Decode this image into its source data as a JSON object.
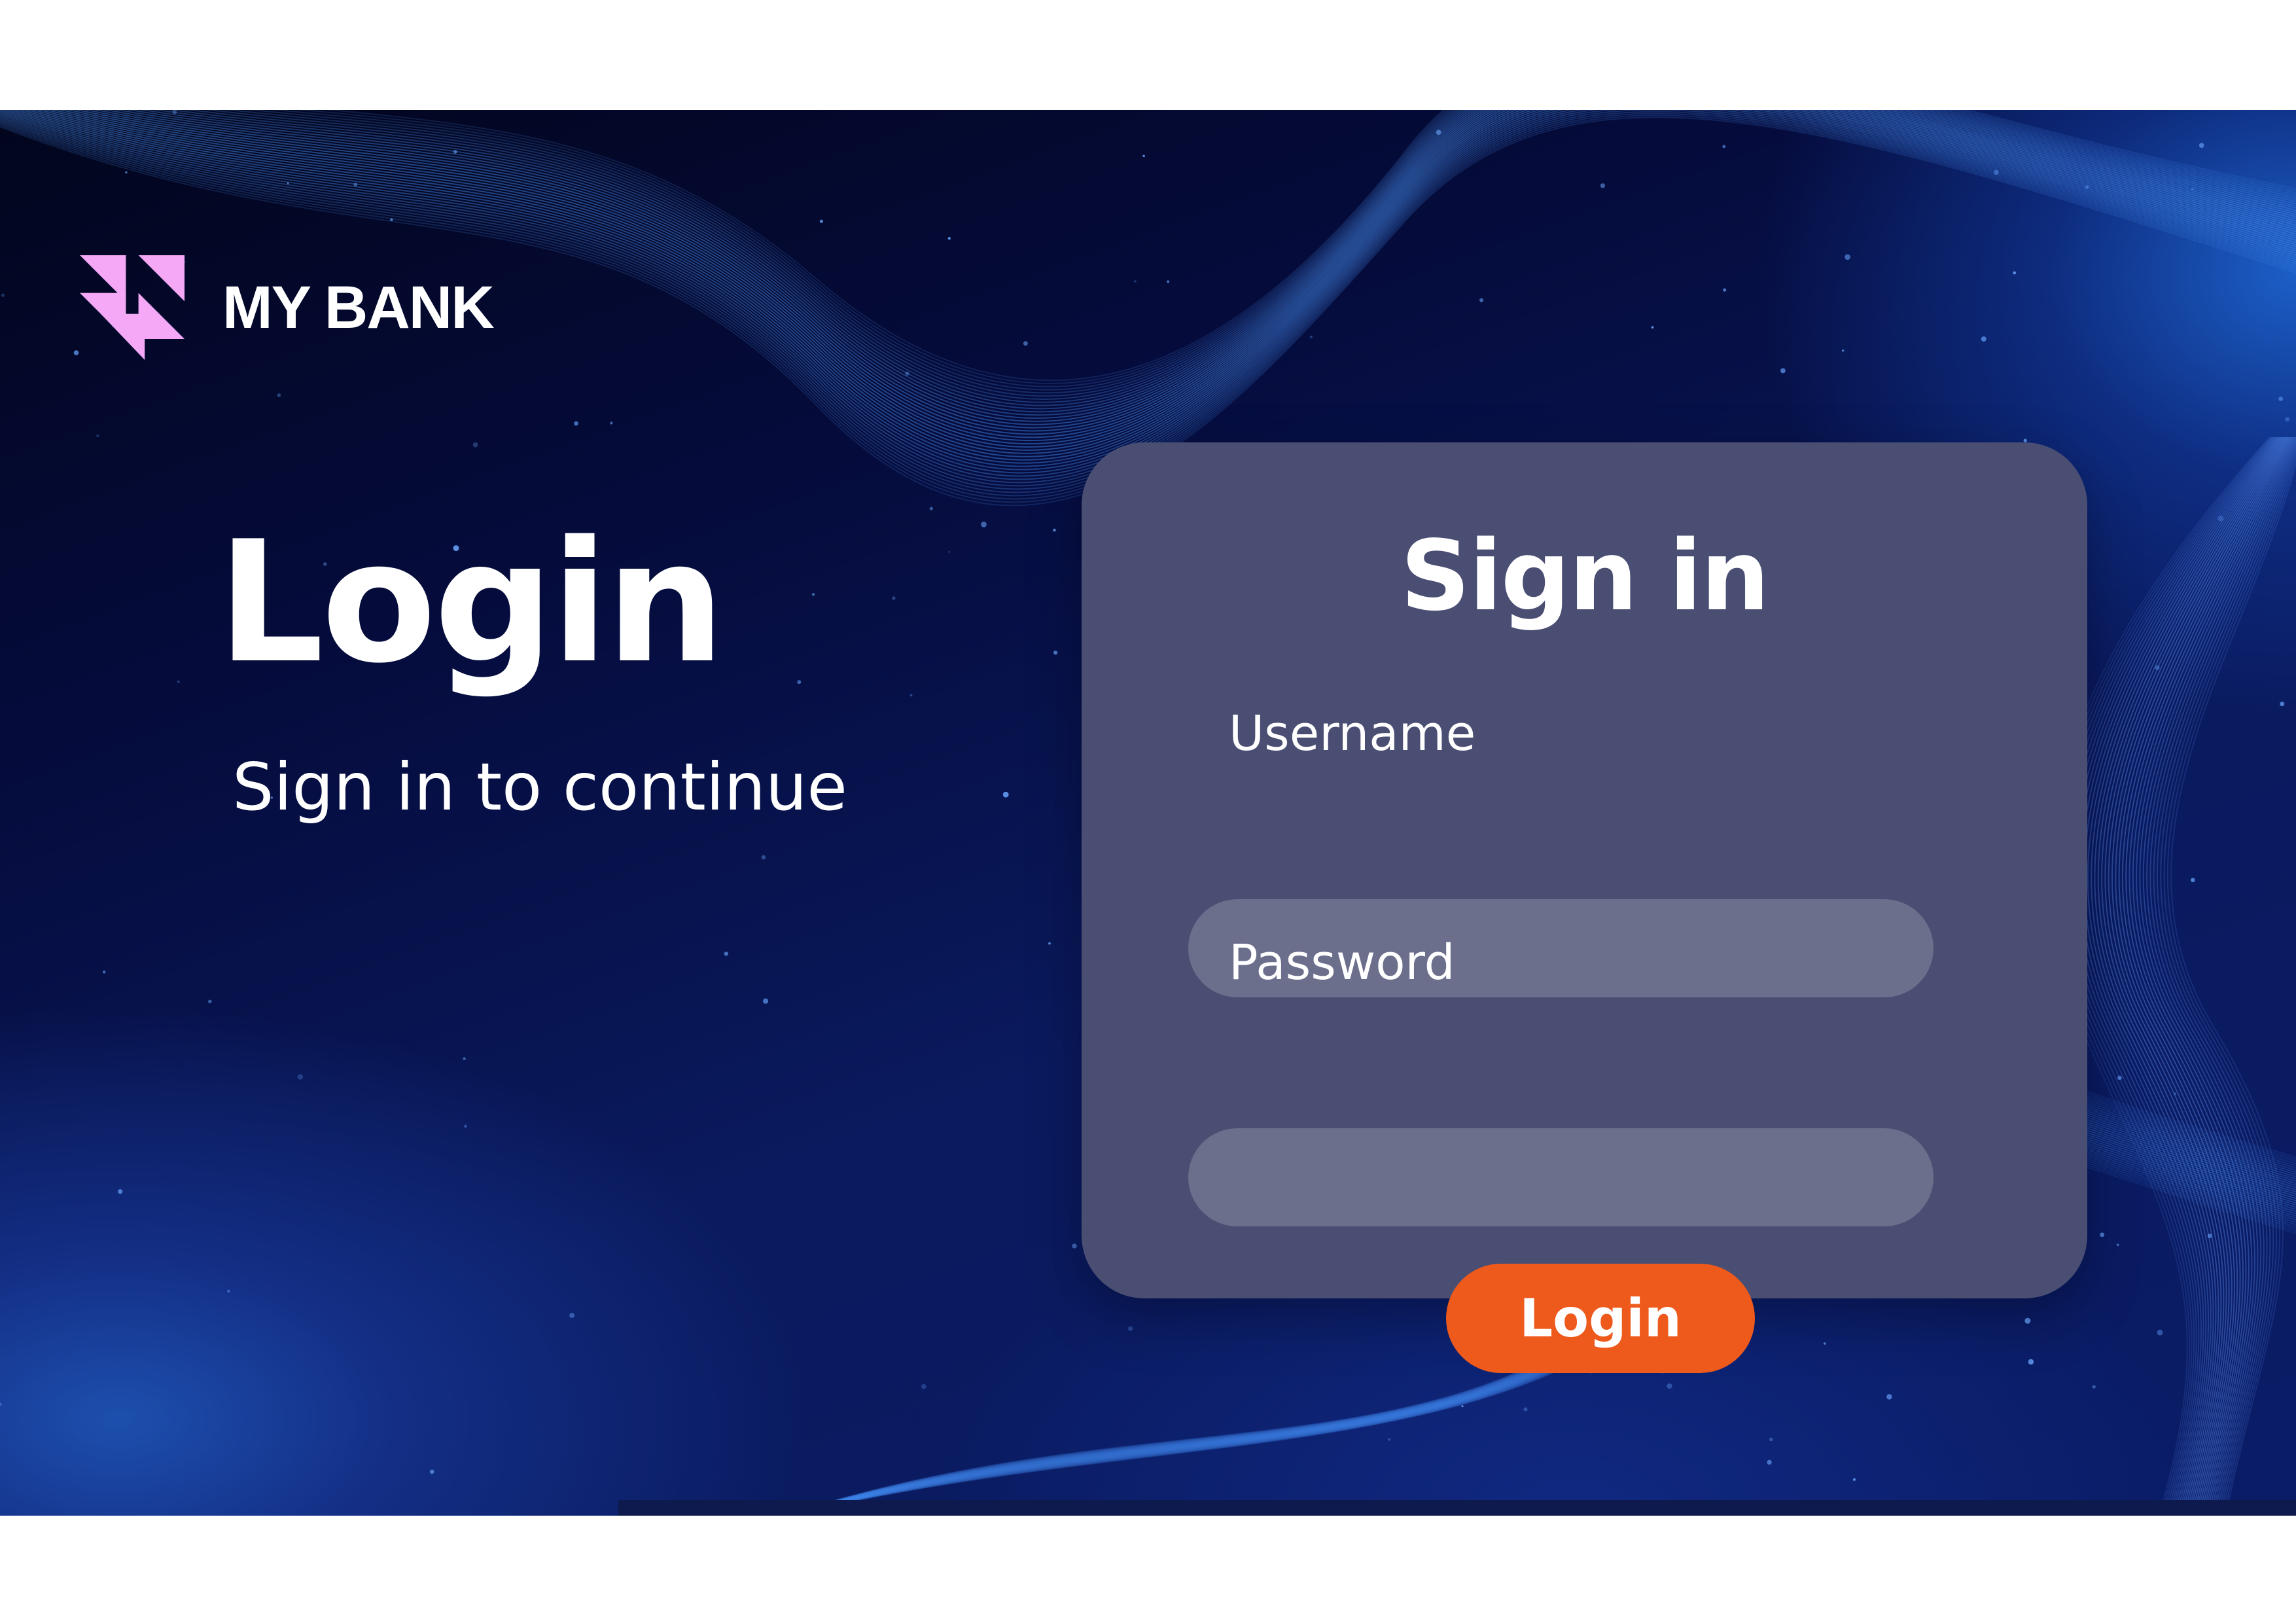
{
  "brand": {
    "name": "MY BANK",
    "logo_icon": "bank-logo-icon",
    "logo_color": "#f4a8f6"
  },
  "hero": {
    "title": "Login",
    "subtitle": "Sign in to continue"
  },
  "signin_card": {
    "title": "Sign in",
    "username": {
      "label": "Username",
      "value": "",
      "placeholder": ""
    },
    "password": {
      "label": "Password",
      "value": "",
      "placeholder": ""
    },
    "login_button_label": "Login"
  },
  "colors": {
    "background": "#050c3d",
    "card": "#4a4e72",
    "input": "#6b6f8b",
    "accent": "#ee5a1c",
    "wave_lines": "#3a8ff0"
  }
}
